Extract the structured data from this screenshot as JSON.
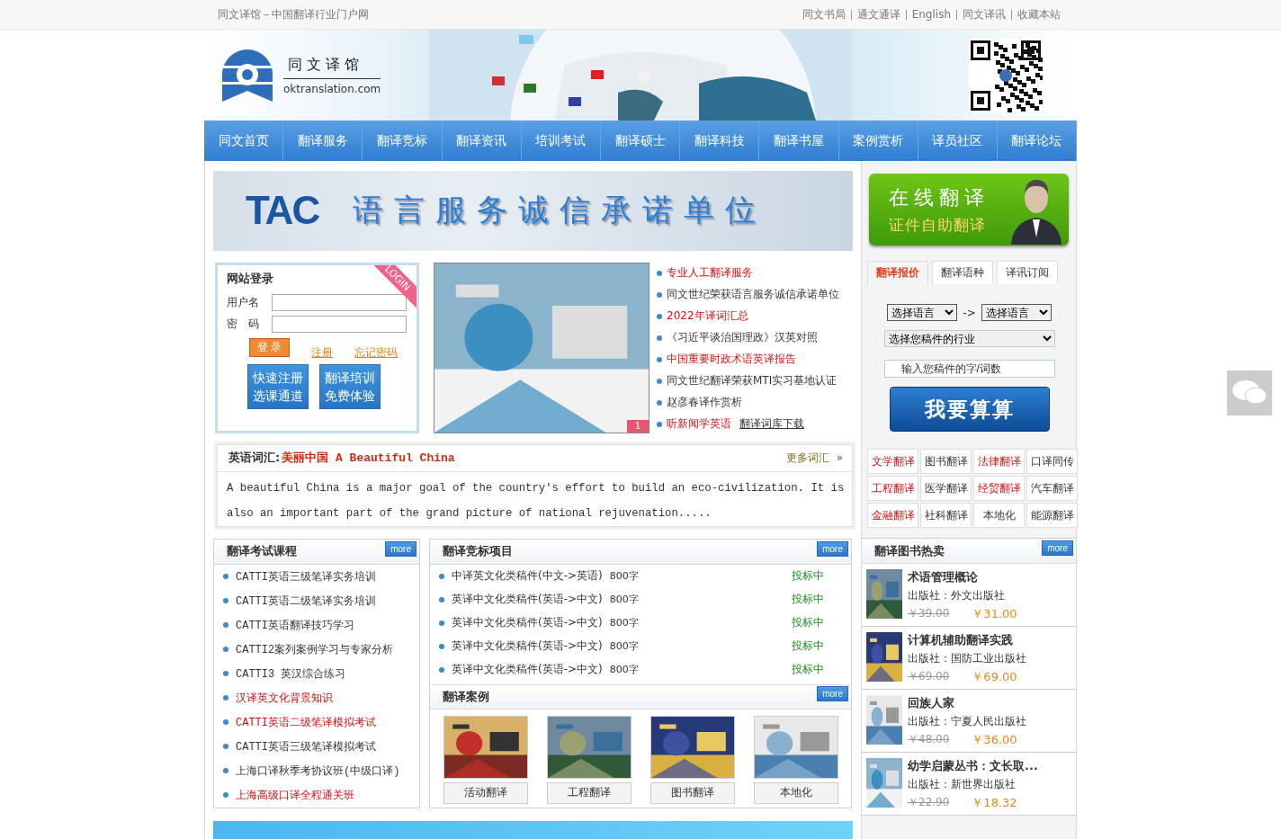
{
  "top_bar": {
    "site_title": "同文译馆－中国翻译行业门户网",
    "links": [
      "同文书局",
      "通文通译",
      "English",
      "同文译讯",
      "收藏本站"
    ]
  },
  "header": {
    "logo_name": "同文译馆",
    "logo_domain": "oktranslation.com"
  },
  "nav": [
    "同文首页",
    "翻译服务",
    "翻译竞标",
    "翻译资讯",
    "培训考试",
    "翻译硕士",
    "翻译科技",
    "翻译书屋",
    "案例赏析",
    "译员社区",
    "翻译论坛"
  ],
  "tac_banner": {
    "logo": "TAC",
    "slogan": "语言服务诚信承诺单位"
  },
  "login": {
    "title": "网站登录",
    "badge": "LOGIN",
    "username_label": "用户名",
    "password_label": "密　码",
    "submit": "登 录",
    "register": "注册",
    "forgot": "忘记密码",
    "promos": [
      [
        "快速注册",
        "选课通道"
      ],
      [
        "翻译培训",
        "免费体验"
      ]
    ]
  },
  "slideshow": {
    "kind": "picture",
    "index": "1"
  },
  "news": [
    {
      "text": "专业人工翻译服务",
      "highlight": true
    },
    {
      "text": "同文世纪荣获语言服务诚信承诺单位",
      "highlight": false
    },
    {
      "text": "2022年译词汇总",
      "highlight": true
    },
    {
      "text": "《习近平谈治国理政》汉英对照",
      "highlight": false
    },
    {
      "text": "中国重要时政术语英译报告",
      "highlight": true
    },
    {
      "text": "同文世纪翻译荣获MTI实习基地认证",
      "highlight": false
    },
    {
      "text": "赵彦春译作赏析",
      "highlight": false
    },
    {
      "text": "听新闻学英语",
      "highlight": true,
      "extra": "翻译词库下载"
    }
  ],
  "vocab": {
    "label": "英语词汇:",
    "term": "美丽中国 A Beautiful China",
    "more": "更多词汇",
    "more_icon": "»",
    "body": "A beautiful China is a major goal of the country's effort to build an eco-civilization. It is also an important part of the grand picture of national rejuvenation....."
  },
  "exam_courses": {
    "title": "翻译考试课程",
    "more": "more",
    "items": [
      {
        "text": "CATTI英语三级笔译实务培训",
        "highlight": false
      },
      {
        "text": "CATTI英语二级笔译实务培训",
        "highlight": false
      },
      {
        "text": "CATTI英语翻译技巧学习",
        "highlight": false
      },
      {
        "text": "CATTI2案列案例学习与专家分析",
        "highlight": false
      },
      {
        "text": "CATTI3 英汉综合练习",
        "highlight": false
      },
      {
        "text": "汉译英文化背景知识",
        "highlight": true
      },
      {
        "text": "CATTI英语二级笔译模拟考试",
        "highlight": true
      },
      {
        "text": "CATTI英语三级笔译模拟考试",
        "highlight": false
      },
      {
        "text": "上海口译秋季考协议班(中级口译)",
        "highlight": false
      },
      {
        "text": "上海高级口译全程通关班",
        "highlight": true
      }
    ]
  },
  "bidding": {
    "title": "翻译竞标项目",
    "more": "more",
    "items": [
      {
        "name": "中译英文化类稿件(中文->英语)",
        "words": "800字",
        "status": "投标中"
      },
      {
        "name": "英译中文化类稿件(英语->中文)",
        "words": "800字",
        "status": "投标中"
      },
      {
        "name": "英译中文化类稿件(英语->中文)",
        "words": "800字",
        "status": "投标中"
      },
      {
        "name": "英译中文化类稿件(英语->中文)",
        "words": "800字",
        "status": "投标中"
      },
      {
        "name": "英译中文化类稿件(英语->中文)",
        "words": "800字",
        "status": "投标中"
      }
    ]
  },
  "cases": {
    "title": "翻译案例",
    "more": "more",
    "items": [
      {
        "label": "活动翻译",
        "kind": "picture"
      },
      {
        "label": "工程翻译",
        "kind": "picture"
      },
      {
        "label": "图书翻译",
        "kind": "picture"
      },
      {
        "label": "本地化",
        "kind": "picture"
      }
    ]
  },
  "online_banner": {
    "title": "在线翻译",
    "subtitle": "证件自助翻译"
  },
  "quote_tabs": [
    {
      "label": "翻译报价",
      "selected": true
    },
    {
      "label": "翻译语种",
      "selected": false
    },
    {
      "label": "译讯订阅",
      "selected": false
    }
  ],
  "quote_form": {
    "source": "选择语言",
    "arrow": "->",
    "target": "选择语言",
    "industry": "选择您稿件的行业",
    "count_placeholder": "输入您稿件的字/词数",
    "submit": "我要算算"
  },
  "categories": [
    {
      "label": "文学翻译",
      "highlight": true
    },
    {
      "label": "图书翻译",
      "highlight": false
    },
    {
      "label": "法律翻译",
      "highlight": true
    },
    {
      "label": "口译同传",
      "highlight": false
    },
    {
      "label": "工程翻译",
      "highlight": true
    },
    {
      "label": "医学翻译",
      "highlight": false
    },
    {
      "label": "经贸翻译",
      "highlight": true
    },
    {
      "label": "汽车翻译",
      "highlight": false
    },
    {
      "label": "金融翻译",
      "highlight": true
    },
    {
      "label": "社科翻译",
      "highlight": false
    },
    {
      "label": "本地化",
      "highlight": false
    },
    {
      "label": "能源翻译",
      "highlight": false
    }
  ],
  "books": {
    "title": "翻译图书热卖",
    "more": "more",
    "items": [
      {
        "title": "术语管理概论",
        "publisher": "出版社：外文出版社",
        "old_price": "￥39.00",
        "price": "￥31.00"
      },
      {
        "title": "计算机辅助翻译实践",
        "publisher": "出版社：国防工业出版社",
        "old_price": "￥69.00",
        "price": "￥69.00"
      },
      {
        "title": "回族人家",
        "publisher": "出版社：宁夏人民出版社",
        "old_price": "￥48.00",
        "price": "￥36.00"
      },
      {
        "title": "幼学启蒙丛书：文长取...",
        "publisher": "出版社：新世界出版社",
        "old_price": "￥22.90",
        "price": "￥18.32"
      }
    ]
  }
}
